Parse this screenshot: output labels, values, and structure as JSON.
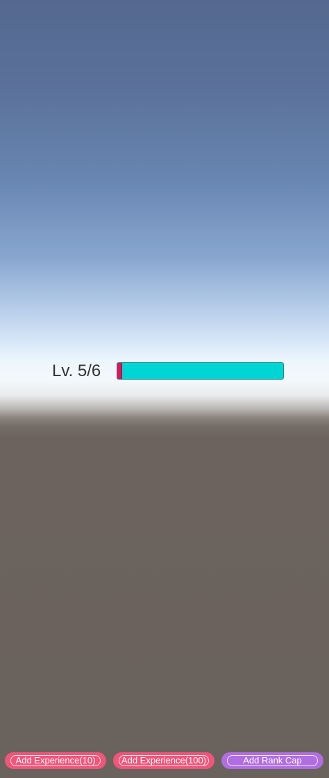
{
  "hud": {
    "level_text": "Lv. 5/6",
    "experience_progress": 0.025
  },
  "buttons": {
    "add_exp_10": "Add Experience(10)",
    "add_exp_100": "Add Experience(100)",
    "add_rank_cap": "Add Rank Cap"
  },
  "colors": {
    "bar_background": "#00d5d5",
    "bar_fill": "#e0135b",
    "button_pink": "#f0557a",
    "button_purple": "#b06ee0"
  }
}
